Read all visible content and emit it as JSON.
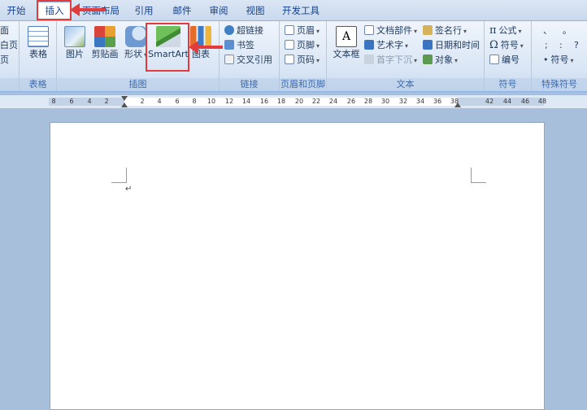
{
  "tabs": [
    {
      "label": "开始"
    },
    {
      "label": "插入"
    },
    {
      "label": "页面布局"
    },
    {
      "label": "引用"
    },
    {
      "label": "邮件"
    },
    {
      "label": "审阅"
    },
    {
      "label": "视图"
    },
    {
      "label": "开发工具"
    }
  ],
  "ribbon": {
    "edge_items": [
      "面",
      "白页",
      "页"
    ],
    "groups": {
      "table": "表格",
      "illustrations": "插图",
      "links": "链接",
      "header_footer": "页眉和页脚",
      "text": "文本",
      "symbols": "符号",
      "special": "特殊符号"
    },
    "table_btn": "表格",
    "picture_btn": "图片",
    "clipart_btn": "剪贴画",
    "shapes_btn": "形状",
    "smartart_btn": "SmartArt",
    "chart_btn": "图表",
    "hyperlink": "超链接",
    "bookmark": "书签",
    "crossref": "交叉引用",
    "header": "页眉",
    "footer": "页脚",
    "pagenum": "页码",
    "textbox": "文本框",
    "quickparts": "文档部件",
    "wordart": "艺术字",
    "dropcap": "首字下沉",
    "signature": "签名行",
    "datetime": "日期和时间",
    "object": "对象",
    "formula": "公式",
    "symbol": "符号",
    "numbering": "编号",
    "special_symbol": "符号",
    "special_chars": [
      "、",
      "。",
      ";",
      ":",
      "?"
    ]
  },
  "ruler": {
    "ticks": [
      "8",
      "6",
      "4",
      "2",
      "2",
      "4",
      "6",
      "8",
      "10",
      "12",
      "14",
      "16",
      "18",
      "20",
      "22",
      "24",
      "26",
      "28",
      "30",
      "32",
      "34",
      "36",
      "38",
      "42",
      "44",
      "46",
      "48"
    ]
  },
  "document": {
    "paragraph_mark": "↵"
  }
}
